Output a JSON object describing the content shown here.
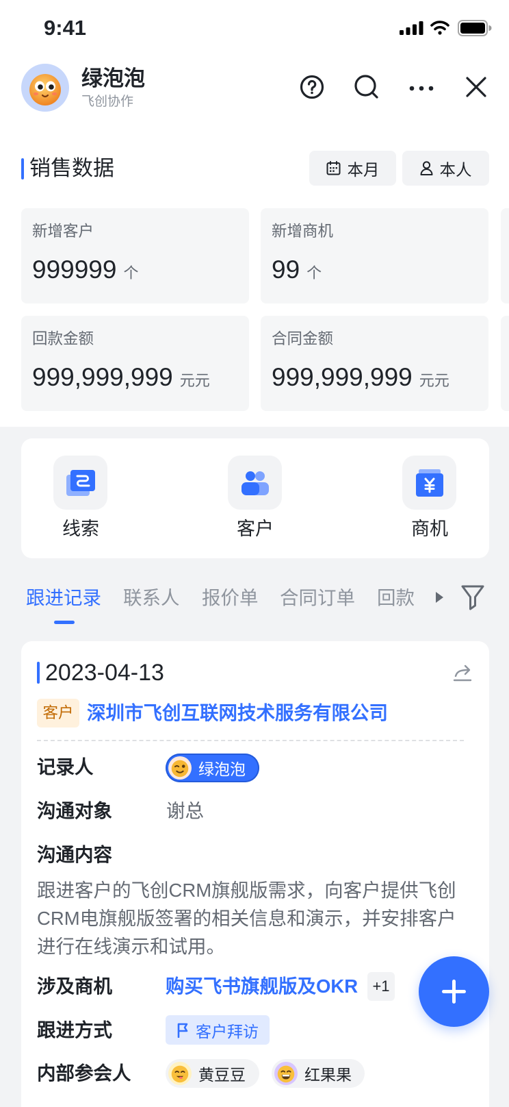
{
  "status_bar": {
    "time": "9:41",
    "icons": [
      "cellular-signal-icon",
      "wifi-icon",
      "battery-icon"
    ]
  },
  "header": {
    "title": "绿泡泡",
    "subtitle": "飞创协作",
    "avatar_icon": "bot-face-avatar",
    "actions": [
      "help-icon",
      "search-icon",
      "more-icon",
      "close-icon"
    ]
  },
  "sales": {
    "title": "销售数据",
    "filters": [
      {
        "label": "本月",
        "icon": "calendar-icon"
      },
      {
        "label": "本人",
        "icon": "person-icon"
      }
    ],
    "stats": [
      {
        "label": "新增客户",
        "value": "999999",
        "unit": "个"
      },
      {
        "label": "新增商机",
        "value": "99",
        "unit": "个"
      },
      {
        "label": "回款金额",
        "value": "999,999,999",
        "unit": "元元"
      },
      {
        "label": "合同金额",
        "value": "999,999,999",
        "unit": "元元"
      }
    ]
  },
  "quick_actions": [
    {
      "label": "线索",
      "icon": "leads-icon"
    },
    {
      "label": "客户",
      "icon": "customers-icon"
    },
    {
      "label": "商机",
      "icon": "opportunities-icon"
    }
  ],
  "tabs": [
    {
      "label": "跟进记录",
      "active": true
    },
    {
      "label": "联系人",
      "active": false
    },
    {
      "label": "报价单",
      "active": false
    },
    {
      "label": "合同订单",
      "active": false
    },
    {
      "label": "回款",
      "active": false
    }
  ],
  "tab_controls": {
    "scroll_icon": "triangle-right-icon",
    "filter_icon": "filter-icon"
  },
  "record": {
    "date": "2023-04-13",
    "share_icon": "share-icon",
    "tag": "客户",
    "company": "深圳市飞创互联网技术服务有限公司",
    "recorder": {
      "label": "记录人",
      "value": "绿泡泡"
    },
    "contact": {
      "label": "沟通对象",
      "value": "谢总"
    },
    "content": {
      "label": "沟通内容",
      "value": "跟进客户的飞创CRM旗舰版需求，向客户提供飞创CRM电旗舰版签署的相关信息和演示，并安排客户进行在线演示和试用。"
    },
    "opportunity": {
      "label": "涉及商机",
      "value": "购买飞书旗舰版及OKR",
      "more": "+1"
    },
    "method": {
      "label": "跟进方式",
      "value": "客户拜访",
      "icon": "flag-icon"
    },
    "attendees": {
      "label": "内部参会人",
      "people": [
        "黄豆豆",
        "红果果"
      ]
    }
  },
  "fab": {
    "icon": "plus-icon"
  },
  "colors": {
    "accent": "#3370ff",
    "text_primary": "#1f2329",
    "text_secondary": "#646a73",
    "text_tertiary": "#8f959e",
    "page_background": "#f2f3f5",
    "stat_card_background": "#f5f6f7",
    "customer_tag_background": "#fff1dd",
    "customer_tag_text": "#c26b05",
    "method_tag_background": "#e1eaff"
  }
}
